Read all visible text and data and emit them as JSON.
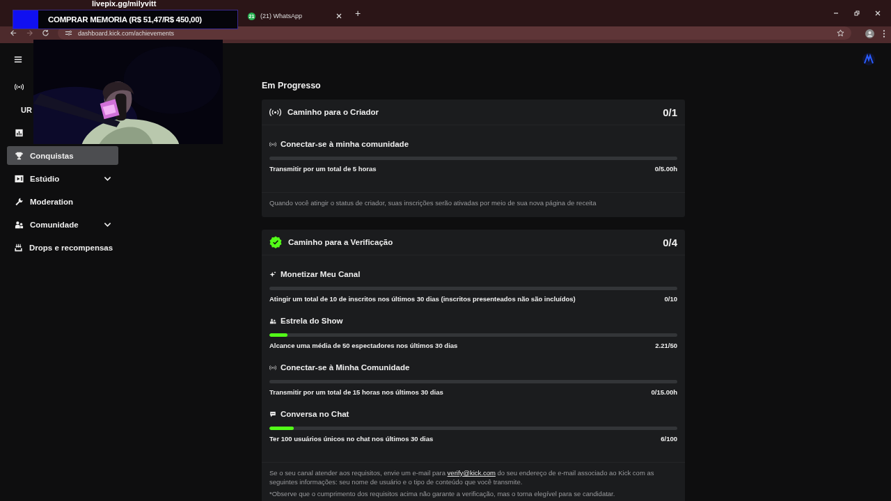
{
  "overlay": {
    "site": "livepix.gg/milyvitt",
    "goal": "COMPRAR MEMORIA (R$ 51,47/R$ 450,00)"
  },
  "browser": {
    "tabs": [
      {
        "badge": "21",
        "title": "(21) WhatsApp",
        "selected": false
      }
    ],
    "new_tab": "+",
    "url": "dashboard.kick.com/achievements"
  },
  "sidebar": {
    "items": [
      {
        "kind": "broadcast",
        "selected": false,
        "expandable": false
      },
      {
        "label": "UR",
        "kind": "plain",
        "selected": false,
        "expandable": false
      },
      {
        "kind": "chart",
        "selected": false,
        "expandable": false
      },
      {
        "label": "Conquistas",
        "kind": "trophy",
        "selected": true,
        "expandable": false
      },
      {
        "label": "Estúdio",
        "kind": "studio",
        "selected": false,
        "expandable": true
      },
      {
        "label": "Moderation",
        "kind": "wrench",
        "selected": false,
        "expandable": false
      },
      {
        "label": "Comunidade",
        "kind": "people",
        "selected": false,
        "expandable": true
      },
      {
        "label": "Drops e recompensas",
        "kind": "drops",
        "selected": false,
        "expandable": false
      }
    ]
  },
  "section_title": "Em Progresso",
  "cards": [
    {
      "title": "Caminho para o Criador",
      "kind": "broadcast",
      "count": "0/1",
      "tasks": [
        {
          "title": "Conectar-se à minha comunidade",
          "kind": "broadcast",
          "description": "Transmitir por um total de 5 horas",
          "reading": "0/5.00h"
        }
      ],
      "notes": [
        {
          "text": "Quando você atingir o status de criador, suas inscrições serão ativadas por meio de sua nova página de receita"
        }
      ]
    },
    {
      "title": "Caminho para a Verificação",
      "kind": "verified",
      "count": "0/4",
      "tasks": [
        {
          "title": "Monetizar Meu Canal",
          "kind": "sparkle",
          "description": "Atingir um total de 10 de inscritos nos últimos 30 dias (inscritos presenteados não são incluídos)",
          "reading": "0/10"
        },
        {
          "title": "Estrela do Show",
          "kind": "people",
          "level": 0.044,
          "description": "Alcance uma média de 50 espectadores nos últimos 30 dias",
          "reading": "2.21/50"
        },
        {
          "title": "Conectar-se à Minha Comunidade",
          "kind": "broadcast",
          "description": "Transmitir por um total de 15 horas nos últimos 30 dias",
          "reading": "0/15.00h"
        },
        {
          "title": "Conversa no Chat",
          "kind": "chat",
          "level": 0.06,
          "description": "Ter 100 usuários únicos no chat nos últimos 30 dias",
          "reading": "6/100"
        }
      ],
      "notes": [
        {
          "text": "Se o seu canal atender aos requisitos, envie um e-mail para ",
          "link": "verify@kick.com",
          "after": " do seu endereço de e-mail associado ao Kick com as seguintes informações: seu nome de usuário e o tipo de conteúdo que você transmite."
        },
        {
          "text": "*Observe que o cumprimento dos requisitos acima não garante a verificação, mas o torna elegível para se candidatar."
        }
      ]
    }
  ]
}
